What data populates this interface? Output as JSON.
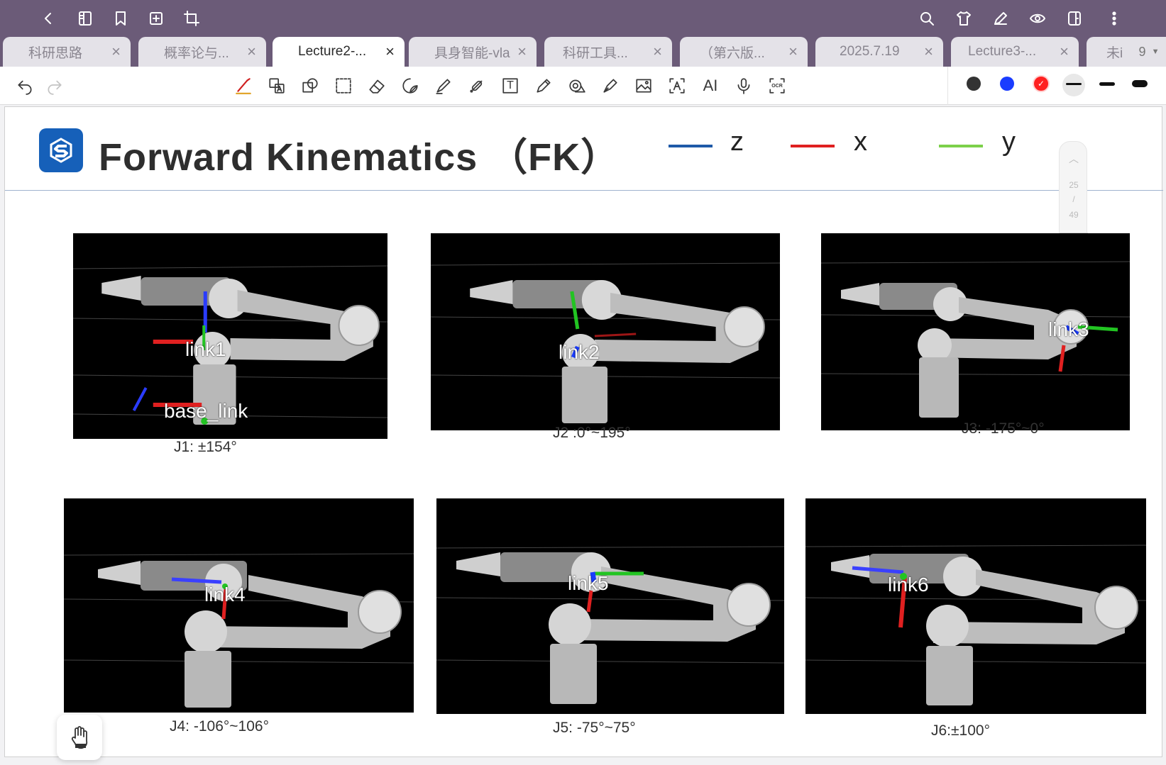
{
  "tabs": [
    {
      "label": "科研思路",
      "active": false
    },
    {
      "label": "概率论与...",
      "active": false
    },
    {
      "label": "Lecture2-...",
      "active": true
    },
    {
      "label": "具身智能-vla",
      "active": false
    },
    {
      "label": "科研工具...",
      "active": false
    },
    {
      "label": "（第六版...",
      "active": false
    },
    {
      "label": "2025.7.19",
      "active": false
    },
    {
      "label": "Lecture3-...",
      "active": false
    },
    {
      "label": "未i",
      "active": false
    }
  ],
  "tab_count": "9",
  "tab_close_glyph": "×",
  "colors": {
    "accent_purple": "#6b5b78",
    "pen_black": "#333333",
    "pen_blue": "#1a3cff",
    "pen_red": "#ff2020",
    "axis_z": "#1f5aa8",
    "axis_x": "#e02020",
    "axis_y": "#7cd04a"
  },
  "toolbar": {
    "text_tool": "T",
    "ai_tool": "AI",
    "ocr_tool": "OCR"
  },
  "slide": {
    "title": "Forward Kinematics （FK）",
    "legend": [
      {
        "axis": "z",
        "color": "#1f5aa8"
      },
      {
        "axis": "x",
        "color": "#e02020"
      },
      {
        "axis": "y",
        "color": "#7cd04a"
      }
    ],
    "page_current": "25",
    "page_sep": "/",
    "page_total": "49"
  },
  "panels": [
    {
      "link": "link1",
      "extra": "base_link",
      "caption": "J1: ±154°"
    },
    {
      "link": "link2",
      "caption": "J2 :0°~195°"
    },
    {
      "link": "link3",
      "caption": "J3: -175°~0°"
    },
    {
      "link": "link4",
      "caption": "J4: -106°~106°"
    },
    {
      "link": "link5",
      "caption": "J5: -75°~75°"
    },
    {
      "link": "link6",
      "caption": "J6:±100°"
    }
  ]
}
